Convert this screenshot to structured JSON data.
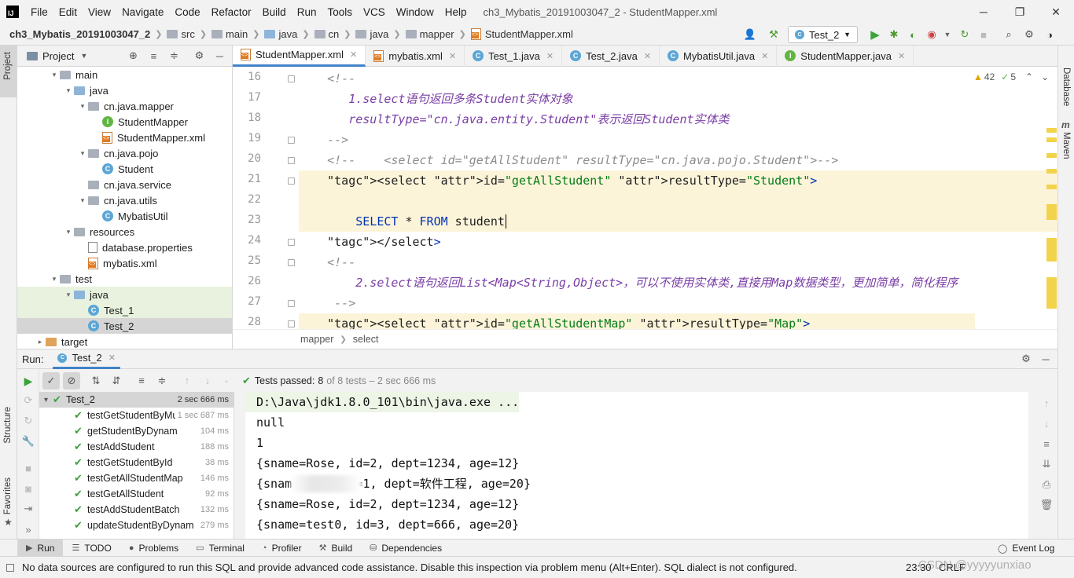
{
  "menu": {
    "logo": "IJ",
    "items": [
      "File",
      "Edit",
      "View",
      "Navigate",
      "Code",
      "Refactor",
      "Build",
      "Run",
      "Tools",
      "VCS",
      "Window",
      "Help"
    ],
    "window_title": "ch3_Mybatis_20191003047_2 - StudentMapper.xml"
  },
  "navbar": {
    "crumbs": [
      "ch3_Mybatis_20191003047_2",
      "src",
      "main",
      "java",
      "cn",
      "java",
      "mapper",
      "StudentMapper.xml"
    ],
    "run_config": "Test_2"
  },
  "project": {
    "header": "Project",
    "tree": [
      {
        "label": "main",
        "indent": 1,
        "arrow": "▾",
        "icon": "folder"
      },
      {
        "label": "java",
        "indent": 2,
        "arrow": "▾",
        "icon": "folder-blue"
      },
      {
        "label": "cn.java.mapper",
        "indent": 3,
        "arrow": "▾",
        "icon": "package"
      },
      {
        "label": "StudentMapper",
        "indent": 4,
        "arrow": "",
        "icon": "interface"
      },
      {
        "label": "StudentMapper.xml",
        "indent": 4,
        "arrow": "",
        "icon": "xml"
      },
      {
        "label": "cn.java.pojo",
        "indent": 3,
        "arrow": "▾",
        "icon": "package"
      },
      {
        "label": "Student",
        "indent": 4,
        "arrow": "",
        "icon": "class"
      },
      {
        "label": "cn.java.service",
        "indent": 3,
        "arrow": "",
        "icon": "package"
      },
      {
        "label": "cn.java.utils",
        "indent": 3,
        "arrow": "▾",
        "icon": "package"
      },
      {
        "label": "MybatisUtil",
        "indent": 4,
        "arrow": "",
        "icon": "class"
      },
      {
        "label": "resources",
        "indent": 2,
        "arrow": "▾",
        "icon": "folder"
      },
      {
        "label": "database.properties",
        "indent": 3,
        "arrow": "",
        "icon": "properties"
      },
      {
        "label": "mybatis.xml",
        "indent": 3,
        "arrow": "",
        "icon": "xml"
      },
      {
        "label": "test",
        "indent": 1,
        "arrow": "▾",
        "icon": "folder"
      },
      {
        "label": "java",
        "indent": 2,
        "arrow": "▾",
        "icon": "folder-blue",
        "highlight": true
      },
      {
        "label": "Test_1",
        "indent": 3,
        "arrow": "",
        "icon": "class",
        "highlight": true
      },
      {
        "label": "Test_2",
        "indent": 3,
        "arrow": "",
        "icon": "class",
        "selected": true
      },
      {
        "label": "target",
        "indent": 0,
        "arrow": "▸",
        "icon": "folder-orange"
      }
    ]
  },
  "editor": {
    "tabs": [
      {
        "label": "StudentMapper.xml",
        "icon": "xml",
        "active": true
      },
      {
        "label": "mybatis.xml",
        "icon": "xml"
      },
      {
        "label": "Test_1.java",
        "icon": "class"
      },
      {
        "label": "Test_2.java",
        "icon": "class"
      },
      {
        "label": "MybatisUtil.java",
        "icon": "class"
      },
      {
        "label": "StudentMapper.java",
        "icon": "interface"
      }
    ],
    "warnings": "42",
    "weak_warnings": "5",
    "lines": [
      {
        "n": "16",
        "text": "    <!--"
      },
      {
        "n": "17",
        "text": "       1.select语句返回多条Student实体对象"
      },
      {
        "n": "18",
        "text": "       resultType=\"cn.java.entity.Student\"表示返回Student实体类"
      },
      {
        "n": "19",
        "text": "    -->"
      },
      {
        "n": "20",
        "text": "    <!--    <select id=\"getAllStudent\" resultType=\"cn.java.pojo.Student\">-->"
      },
      {
        "n": "21",
        "text": "    <select id=\"getAllStudent\" resultType=\"Student\">"
      },
      {
        "n": "22",
        "text": ""
      },
      {
        "n": "23",
        "text": "        SELECT * FROM student"
      },
      {
        "n": "24",
        "text": "    </select>"
      },
      {
        "n": "25",
        "text": "    <!--"
      },
      {
        "n": "26",
        "text": "        2.select语句返回List<Map<String,Object>，可以不使用实体类,直接用Map数据类型，更加简单，简化程序"
      },
      {
        "n": "27",
        "text": "     -->"
      },
      {
        "n": "28",
        "text": "    <select id=\"getAllStudentMap\" resultType=\"Map\">"
      }
    ],
    "breadcrumb": [
      "mapper",
      "select"
    ]
  },
  "run": {
    "label": "Run:",
    "config_tab": "Test_2",
    "tests_passed_label": "Tests passed:",
    "tests_passed_count": "8",
    "tests_summary": "of 8 tests – 2 sec 666 ms",
    "tests": [
      {
        "name": "Test_2",
        "time": "2 sec 666 ms",
        "root": true
      },
      {
        "name": "testGetStudentByMu",
        "time": "1 sec 687 ms"
      },
      {
        "name": "getStudentByDynam",
        "time": "104 ms"
      },
      {
        "name": "testAddStudent",
        "time": "188 ms"
      },
      {
        "name": "testGetStudentById",
        "time": "38 ms"
      },
      {
        "name": "testGetAllStudentMap",
        "time": "146 ms"
      },
      {
        "name": "testGetAllStudent",
        "time": "92 ms"
      },
      {
        "name": "testAddStudentBatch",
        "time": "132 ms"
      },
      {
        "name": "updateStudentByDynam",
        "time": "279 ms"
      }
    ],
    "console": [
      "D:\\Java\\jdk1.8.0_101\\bin\\java.exe ...",
      "null",
      "1",
      "{sname=Rose, id=2, dept=1234, age=12}",
      "{snam       id=1, dept=软件工程, age=20}",
      "{sname=Rose, id=2, dept=1234, age=12}",
      "{sname=test0, id=3, dept=666, age=20}"
    ]
  },
  "bottom_tools": [
    "Run",
    "TODO",
    "Problems",
    "Terminal",
    "Profiler",
    "Build",
    "Dependencies"
  ],
  "event_log": "Event Log",
  "left_stripe": {
    "project": "Project",
    "structure": "Structure",
    "favorites": "Favorites"
  },
  "right_stripe": {
    "database": "Database",
    "maven": "Maven"
  },
  "status": {
    "message": "No data sources are configured to run this SQL and provide advanced code assistance. Disable this inspection via problem menu (Alt+Enter). SQL dialect is not configured.",
    "position": "23:30",
    "line_sep": "CRLF",
    "watermark": "CSDN @yyyyyunxiao"
  }
}
